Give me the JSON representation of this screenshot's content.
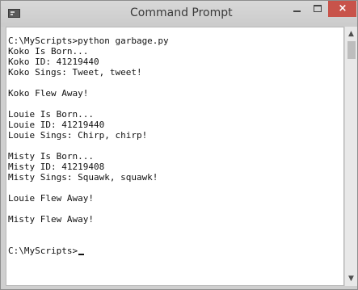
{
  "window": {
    "title": "Command Prompt",
    "icon": "console-icon",
    "controls": {
      "minimize": "minimize-icon",
      "maximize": "maximize-icon",
      "close_glyph": "×"
    }
  },
  "console": {
    "lines": [
      "C:\\MyScripts>python garbage.py",
      "Koko Is Born...",
      "Koko ID: 41219440",
      "Koko Sings: Tweet, tweet!",
      "",
      "Koko Flew Away!",
      "",
      "Louie Is Born...",
      "Louie ID: 41219440",
      "Louie Sings: Chirp, chirp!",
      "",
      "Misty Is Born...",
      "Misty ID: 41219408",
      "Misty Sings: Squawk, squawk!",
      "",
      "Louie Flew Away!",
      "",
      "Misty Flew Away!",
      "",
      "",
      "C:\\MyScripts>"
    ]
  },
  "scrollbar": {
    "up_arrow": "▲",
    "down_arrow": "▼"
  },
  "colors": {
    "close_button": "#c8534a",
    "console_background": "#ffffff",
    "text": "#111111"
  }
}
